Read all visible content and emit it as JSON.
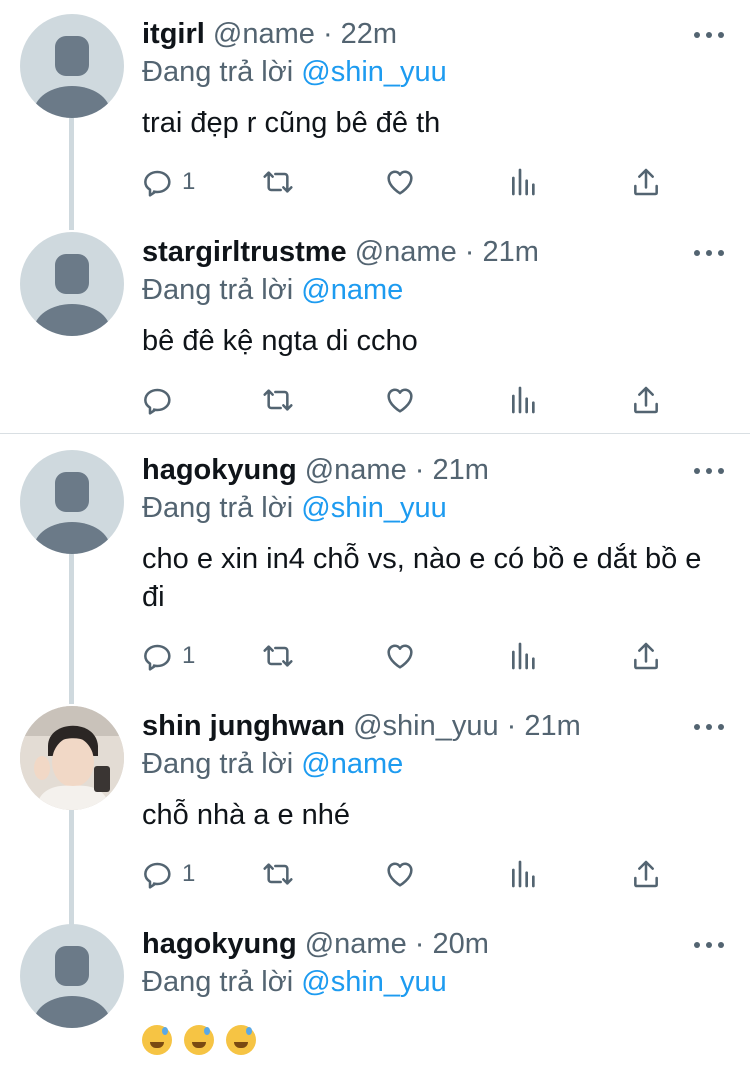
{
  "reply_prefix": "Đang trả lời",
  "tweets": [
    {
      "name": "itgirl",
      "handle": "@name · 22m",
      "reply_to": "@shin_yuu",
      "text": "trai đẹp r cũng bê đê th",
      "replies": "1"
    },
    {
      "name": "stargirltrustme",
      "handle": "@name · 21m",
      "reply_to": "@name",
      "text": "bê đê kệ ngta di ccho",
      "replies": ""
    },
    {
      "name": "hagokyung",
      "handle": "@name · 21m",
      "reply_to": "@shin_yuu",
      "text": "cho e xin in4 chỗ vs, nào e có bồ e dắt bồ e đi",
      "replies": "1"
    },
    {
      "name": "shin junghwan",
      "handle": "@shin_yuu · 21m",
      "reply_to": "@name",
      "text": "chỗ nhà a e nhé",
      "replies": "1"
    },
    {
      "name": "hagokyung",
      "handle": "@name · 20m",
      "reply_to": "@shin_yuu",
      "text": "",
      "replies": ""
    }
  ],
  "last_tweet_emoji": [
    "grinning-sweat-emoji",
    "grinning-sweat-emoji",
    "grinning-sweat-emoji"
  ],
  "colors": {
    "link": "#1d9bf0",
    "secondary": "#536471",
    "line": "#cfd9de"
  }
}
